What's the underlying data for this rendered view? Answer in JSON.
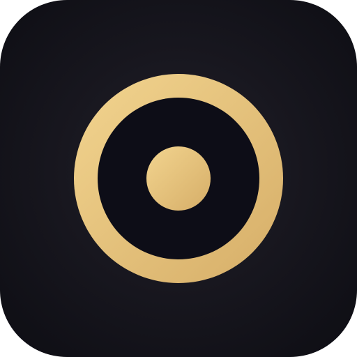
{
  "icon": {
    "name": "record-target-icon",
    "background_color": "#111118",
    "accent_color": "#e8c47c",
    "accent_color_light": "#f2d48f",
    "accent_color_dark": "#d6ae68",
    "inner_fill_color": "#0d0d17"
  }
}
